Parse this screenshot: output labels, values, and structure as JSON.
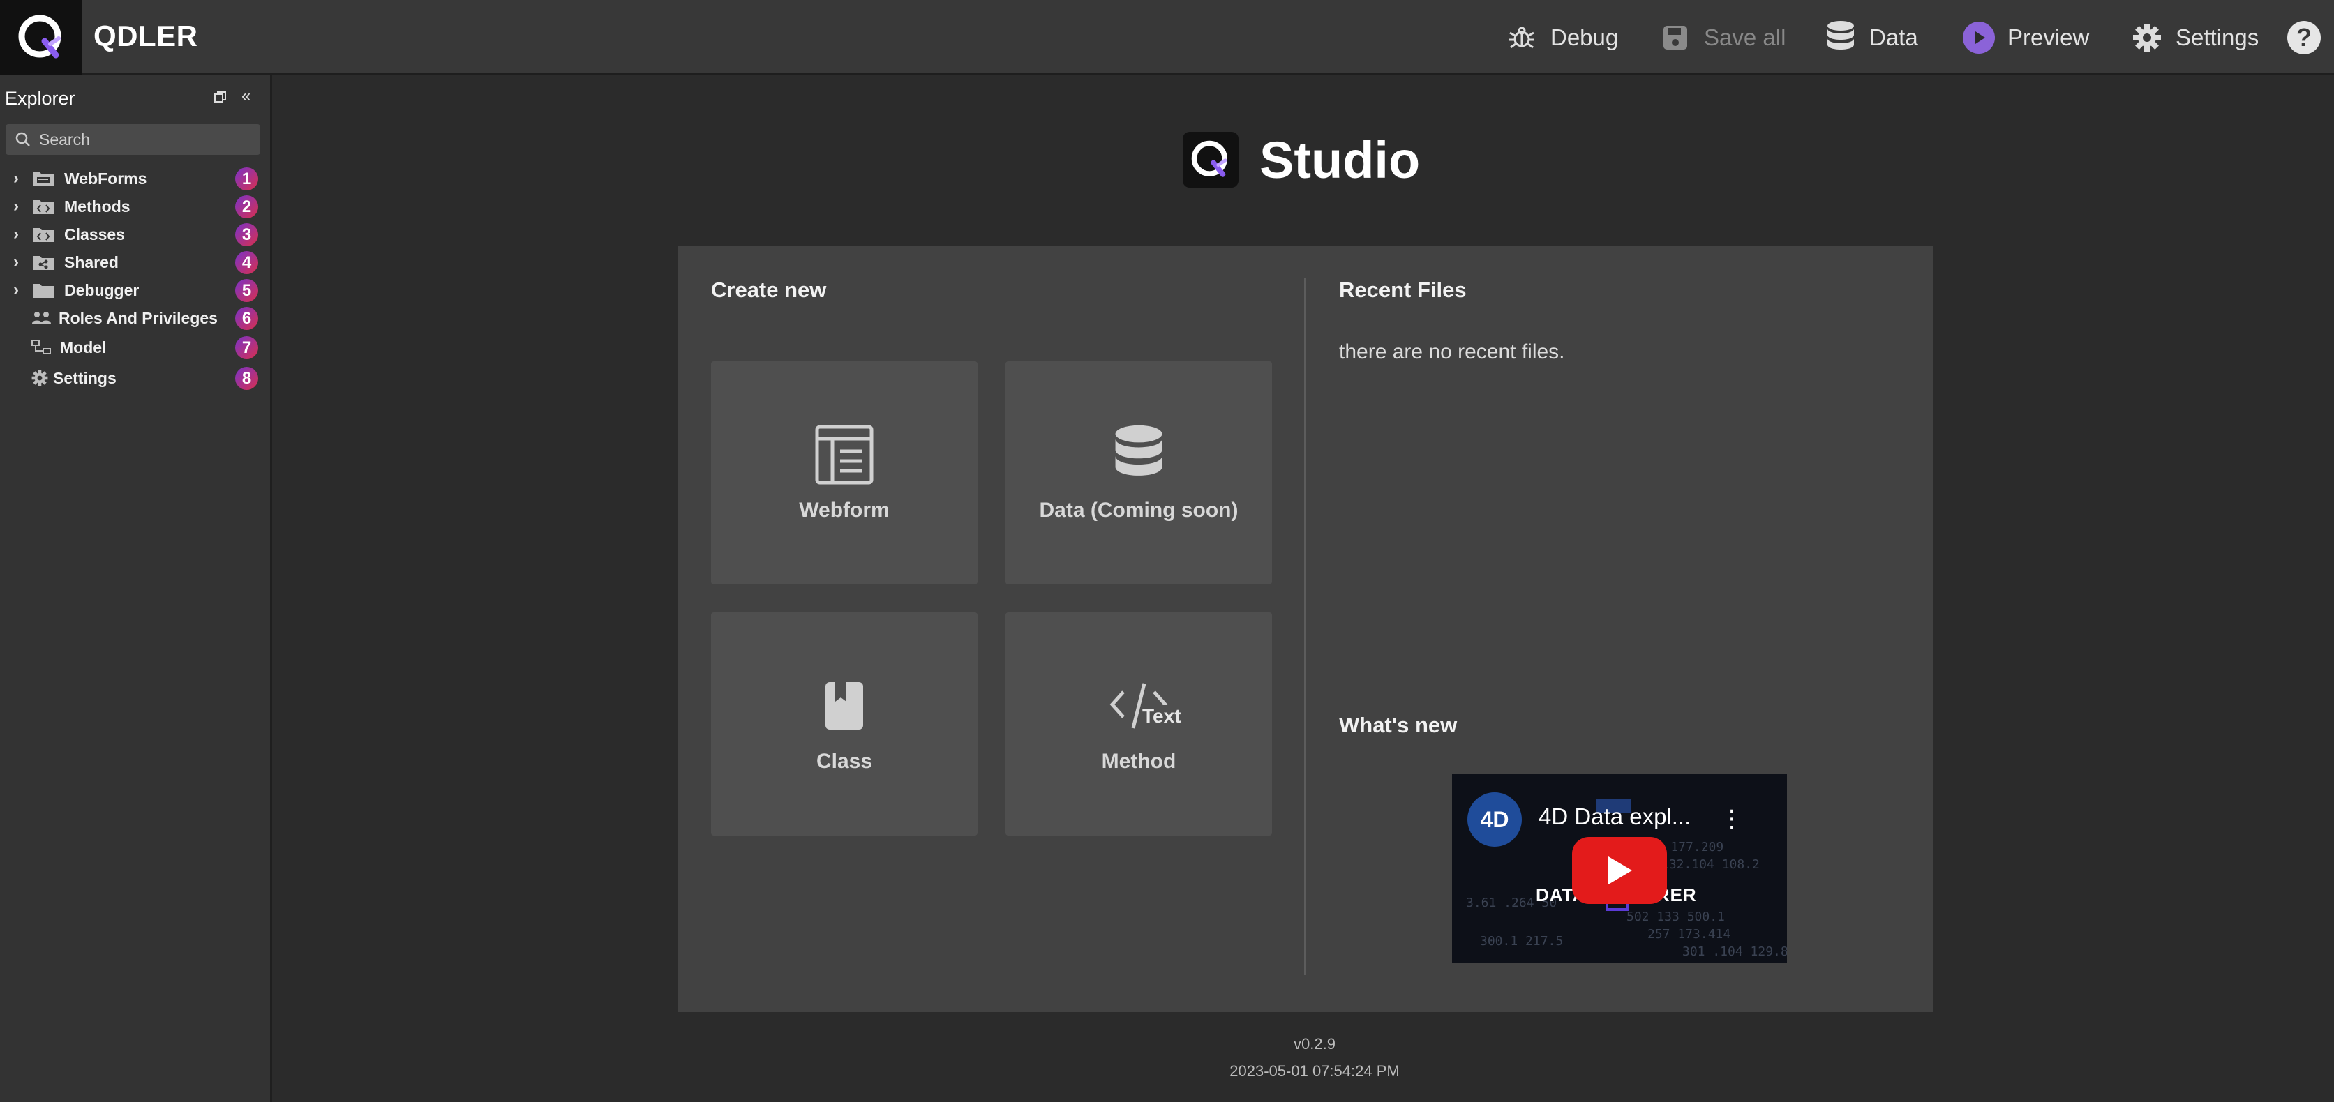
{
  "app": {
    "name": "QDLER"
  },
  "toolbar": {
    "debug_label": "Debug",
    "save_all_label": "Save all",
    "data_label": "Data",
    "preview_label": "Preview",
    "settings_label": "Settings"
  },
  "sidebar": {
    "title": "Explorer",
    "search_placeholder": "Search",
    "items": [
      {
        "label": "WebForms",
        "icon": "webforms-folder-icon",
        "badge": "1",
        "expandable": true
      },
      {
        "label": "Methods",
        "icon": "methods-folder-icon",
        "badge": "2",
        "expandable": true
      },
      {
        "label": "Classes",
        "icon": "classes-folder-icon",
        "badge": "3",
        "expandable": true
      },
      {
        "label": "Shared",
        "icon": "shared-folder-icon",
        "badge": "4",
        "expandable": true
      },
      {
        "label": "Debugger",
        "icon": "debugger-folder-icon",
        "badge": "5",
        "expandable": true
      },
      {
        "label": "Roles And Privileges",
        "icon": "users-icon",
        "badge": "6",
        "expandable": false
      },
      {
        "label": "Model",
        "icon": "model-icon",
        "badge": "7",
        "expandable": false
      },
      {
        "label": "Settings",
        "icon": "gear-icon",
        "badge": "8",
        "expandable": false
      }
    ]
  },
  "main": {
    "title": "Studio",
    "create_new": {
      "title": "Create new",
      "tiles": [
        {
          "label": "Webform",
          "icon": "webform-icon"
        },
        {
          "label": "Data (Coming soon)",
          "icon": "database-icon"
        },
        {
          "label": "Class",
          "icon": "bookmark-icon"
        },
        {
          "label": "Method",
          "icon": "code-icon",
          "icon_text": "Text"
        }
      ]
    },
    "recent_files": {
      "title": "Recent Files",
      "empty_text": "there are no recent files."
    },
    "whats_new": {
      "title": "What's new",
      "video": {
        "channel": "4D",
        "title": "4D Data expl...",
        "caption": "DATA EXPLORER"
      }
    }
  },
  "footer": {
    "version": "v0.2.9",
    "timestamp": "2023-05-01 07:54:24 PM"
  },
  "colors": {
    "accent": "#7a5cd6",
    "badge_from": "#7a33c8",
    "badge_to": "#d9304e",
    "play": "#e31b1b"
  }
}
